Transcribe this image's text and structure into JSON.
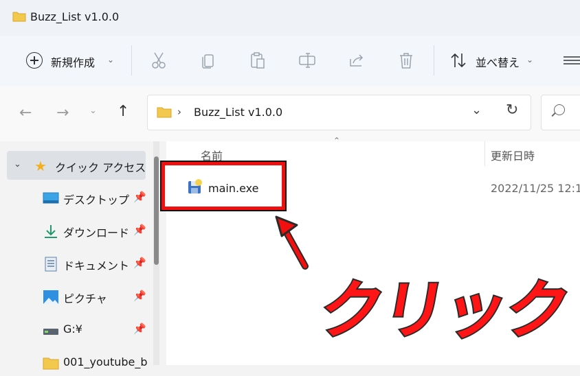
{
  "window": {
    "title": "Buzz_List v1.0.0"
  },
  "toolbar": {
    "new_label": "新規作成",
    "sort_label": "並べ替え",
    "icons": [
      "plus-circle-icon",
      "cut-icon",
      "copy-icon",
      "paste-icon",
      "rename-icon",
      "share-icon",
      "delete-icon",
      "sort-icon",
      "view-icon"
    ]
  },
  "address": {
    "path": "Buzz_List v1.0.0"
  },
  "nav": {
    "quick_access": "クイック アクセス",
    "items": [
      {
        "label": "デスクトップ",
        "icon": "desktop-icon",
        "pinned": true
      },
      {
        "label": "ダウンロード",
        "icon": "download-icon",
        "pinned": true
      },
      {
        "label": "ドキュメント",
        "icon": "document-icon",
        "pinned": true
      },
      {
        "label": "ピクチャ",
        "icon": "pictures-icon",
        "pinned": true
      },
      {
        "label": "G:¥",
        "icon": "drive-icon",
        "pinned": true
      },
      {
        "label": "001_youtube_b",
        "icon": "folder-icon",
        "pinned": false
      }
    ]
  },
  "columns": {
    "name": "名前",
    "modified": "更新日時"
  },
  "files": [
    {
      "name": "main.exe",
      "modified": "2022/11/25 12:1"
    }
  ],
  "annotation": {
    "text": "クリック"
  },
  "colors": {
    "accent_red": "#f01010",
    "folder": "#f2c94c",
    "star": "#f2b01e"
  }
}
